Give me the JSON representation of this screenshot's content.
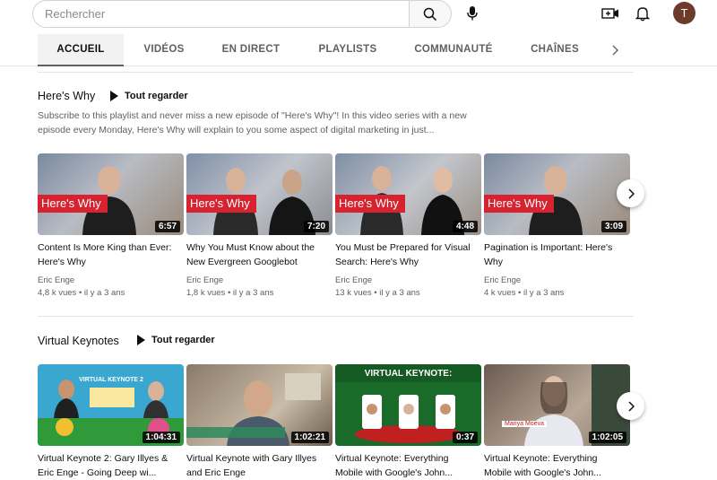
{
  "search": {
    "placeholder": "Rechercher"
  },
  "avatar": {
    "letter": "T"
  },
  "tabs": [
    {
      "label": "ACCUEIL",
      "active": true
    },
    {
      "label": "VIDÉOS"
    },
    {
      "label": "EN DIRECT"
    },
    {
      "label": "PLAYLISTS"
    },
    {
      "label": "COMMUNAUTÉ"
    },
    {
      "label": "CHAÎNES"
    }
  ],
  "sections": [
    {
      "title": "Here's Why",
      "play_all": "Tout regarder",
      "description": "Subscribe to this playlist and never miss a new episode of \"Here's Why\"! In this video series with a new episode every Monday, Here's Why will explain to you some aspect of digital marketing in just...",
      "videos": [
        {
          "title": "Content Is More King than Ever: Here's Why",
          "channel": "Eric Enge",
          "stats": "4,8 k vues • il y a 3 ans",
          "duration": "6:57",
          "overlay": "Here's Why"
        },
        {
          "title": "Why You Must Know about the New Evergreen Googlebot",
          "channel": "Eric Enge",
          "stats": "1,8 k vues • il y a 3 ans",
          "duration": "7:20",
          "overlay": "Here's Why"
        },
        {
          "title": "You Must be Prepared for Visual Search: Here's Why",
          "channel": "Eric Enge",
          "stats": "13 k vues • il y a 3 ans",
          "duration": "4:48",
          "overlay": "Here's Why"
        },
        {
          "title": "Pagination is Important: Here's Why",
          "channel": "Eric Enge",
          "stats": "4 k vues • il y a 3 ans",
          "duration": "3:09",
          "overlay": "Here's Why"
        }
      ]
    },
    {
      "title": "Virtual Keynotes",
      "play_all": "Tout regarder",
      "videos": [
        {
          "title": "Virtual Keynote 2: Gary Illyes & Eric Enge - Going Deep wi...",
          "duration": "1:04:31",
          "overlay": "VIRTUAL KEYNOTE 2"
        },
        {
          "title": "Virtual Keynote with Gary Illyes and Eric Enge",
          "duration": "1:02:21"
        },
        {
          "title": "Virtual Keynote: Everything Mobile with Google's John...",
          "duration": "0:37",
          "overlay": "VIRTUAL KEYNOTE:"
        },
        {
          "title": "Virtual Keynote: Everything Mobile with Google's John...",
          "duration": "1:02:05",
          "overlay": "Mariya Moeva"
        }
      ]
    }
  ],
  "colors": {
    "accent_red": "#d6232f",
    "avatar": "#6d3b2c"
  }
}
